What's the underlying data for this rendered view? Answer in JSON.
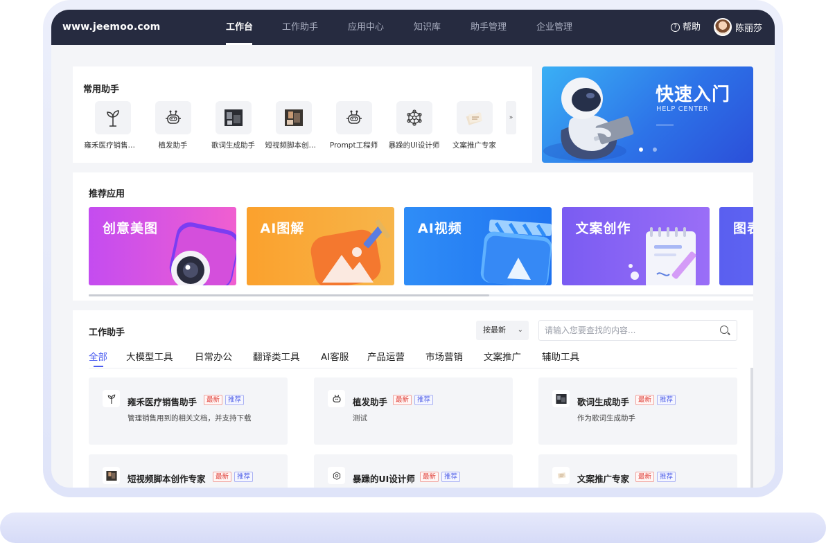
{
  "brand": "www.jeemoo.com",
  "nav": {
    "items": [
      {
        "label": "工作台",
        "active": true
      },
      {
        "label": "工作助手",
        "active": false
      },
      {
        "label": "应用中心",
        "active": false
      },
      {
        "label": "知识库",
        "active": false
      },
      {
        "label": "助手管理",
        "active": false
      },
      {
        "label": "企业管理",
        "active": false
      }
    ],
    "help_label": "帮助",
    "user_name": "陈丽莎"
  },
  "common": {
    "title": "常用助手",
    "items": [
      {
        "label": "雍禾医疗销售助手",
        "icon": "sprout-icon"
      },
      {
        "label": "植发助手",
        "icon": "robot-icon"
      },
      {
        "label": "歌词生成助手",
        "icon": "photo-thumbnail"
      },
      {
        "label": "短视频脚本创作专家",
        "icon": "photo-thumbnail"
      },
      {
        "label": "Prompt工程师",
        "icon": "robot-icon"
      },
      {
        "label": "暴躁的UI设计师",
        "icon": "network-icon"
      },
      {
        "label": "文案推广专家",
        "icon": "paper-thumbnail"
      }
    ],
    "more_icon": "chevron-down-double-icon"
  },
  "banner": {
    "title": "快速入门",
    "subtitle": "HELP CENTER",
    "slides": 2,
    "active_slide": 1
  },
  "recommend": {
    "title": "推荐应用",
    "apps": [
      {
        "label": "创意美图",
        "color_from": "#c44cf0",
        "color_to": "#f05fd0"
      },
      {
        "label": "AI图解",
        "color_from": "#fba12d",
        "color_to": "#f7b54a"
      },
      {
        "label": "AI视频",
        "color_from": "#2f8df7",
        "color_to": "#1f73f0"
      },
      {
        "label": "文案创作",
        "color_from": "#7a5cf2",
        "color_to": "#9a6ef7"
      },
      {
        "label": "图表",
        "color_from": "#5a5ff0",
        "color_to": "#6b6ff5"
      }
    ]
  },
  "work": {
    "title": "工作助手",
    "sort_label": "按最新",
    "search_placeholder": "请输入您要查找的内容...",
    "tabs": [
      {
        "label": "全部",
        "active": true
      },
      {
        "label": "大模型工具",
        "active": false
      },
      {
        "label": "日常办公",
        "active": false
      },
      {
        "label": "翻译类工具",
        "active": false
      },
      {
        "label": "AI客服",
        "active": false
      },
      {
        "label": "产品运营",
        "active": false
      },
      {
        "label": "市场营销",
        "active": false
      },
      {
        "label": "文案推广",
        "active": false
      },
      {
        "label": "辅助工具",
        "active": false
      }
    ],
    "badge_new": "最新",
    "badge_rec": "推荐",
    "cards": [
      {
        "title": "雍禾医疗销售助手",
        "desc": "管理销售用到的相关文档，并支持下载",
        "icon": "sprout-icon"
      },
      {
        "title": "植发助手",
        "desc": "测试",
        "icon": "robot-icon"
      },
      {
        "title": "歌词生成助手",
        "desc": "作为歌词生成助手",
        "icon": "photo-thumbnail"
      },
      {
        "title": "短视频脚本创作专家",
        "desc": "",
        "icon": "photo-thumbnail"
      },
      {
        "title": "暴躁的UI设计师",
        "desc": "",
        "icon": "network-icon"
      },
      {
        "title": "文案推广专家",
        "desc": "",
        "icon": "paper-thumbnail"
      }
    ]
  }
}
